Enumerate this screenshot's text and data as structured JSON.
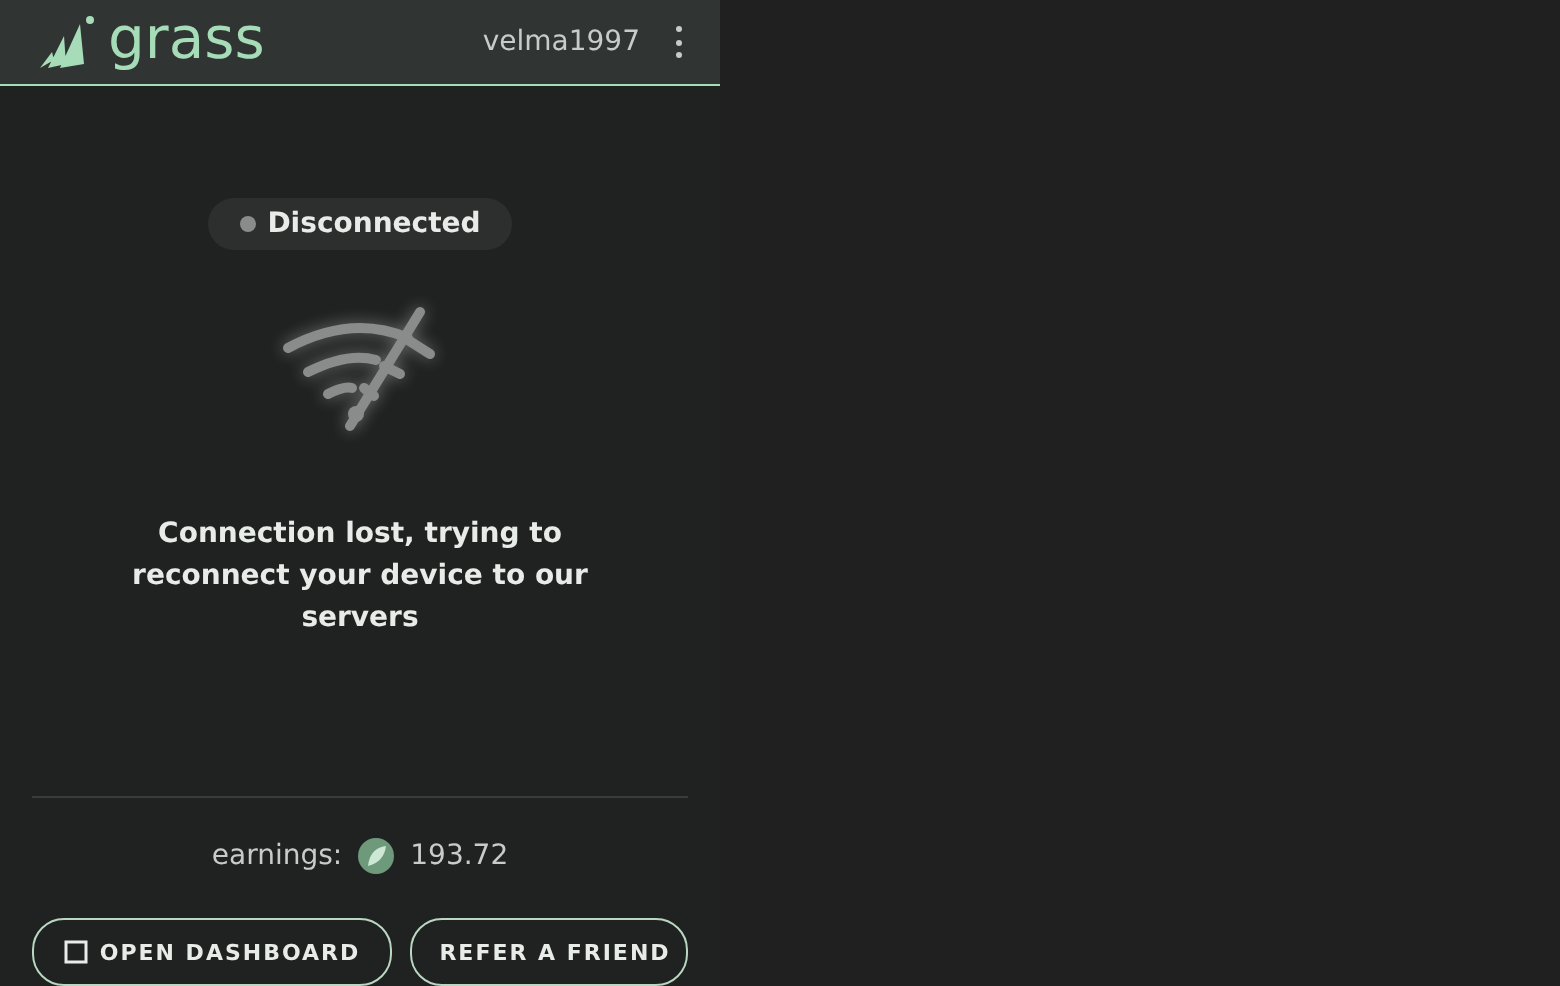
{
  "header": {
    "logo": "grass",
    "username": "velma1997"
  },
  "status": {
    "label": "Disconnected",
    "connected": false
  },
  "message": "Connection lost, trying to reconnect your device to our servers",
  "earnings": {
    "label": "earnings:",
    "value": "193.72"
  },
  "buttons": [
    {
      "label": "OPEN DASHBOARD",
      "kind": "dashboard"
    },
    {
      "label": "REFER A FRIEND",
      "kind": "refer"
    }
  ]
}
